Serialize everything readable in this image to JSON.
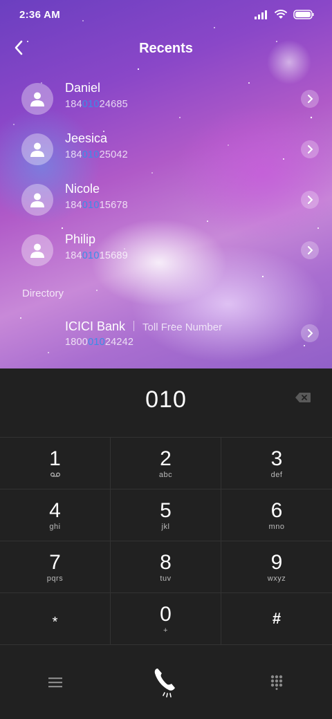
{
  "status": {
    "time": "2:36 AM"
  },
  "header": {
    "title": "Recents"
  },
  "contacts": [
    {
      "name": "Daniel",
      "num_pre": "184",
      "num_hl": "010",
      "num_post": "24685"
    },
    {
      "name": "Jeesica",
      "num_pre": "184",
      "num_hl": "010",
      "num_post": "25042"
    },
    {
      "name": "Nicole",
      "num_pre": "184",
      "num_hl": "010",
      "num_post": "15678"
    },
    {
      "name": "Philip",
      "num_pre": "184",
      "num_hl": "010",
      "num_post": "15689"
    }
  ],
  "directory": {
    "label": "Directory",
    "entry": {
      "name": "ICICI Bank",
      "subtitle": "Toll Free Number",
      "num_pre": "1800",
      "num_hl": "010",
      "num_post": "24242"
    }
  },
  "dialer": {
    "input": "010",
    "keys": [
      {
        "digit": "1",
        "letters": ""
      },
      {
        "digit": "2",
        "letters": "abc"
      },
      {
        "digit": "3",
        "letters": "def"
      },
      {
        "digit": "4",
        "letters": "ghi"
      },
      {
        "digit": "5",
        "letters": "jkl"
      },
      {
        "digit": "6",
        "letters": "mno"
      },
      {
        "digit": "7",
        "letters": "pqrs"
      },
      {
        "digit": "8",
        "letters": "tuv"
      },
      {
        "digit": "9",
        "letters": "wxyz"
      },
      {
        "digit": "*",
        "letters": ""
      },
      {
        "digit": "0",
        "letters": "+"
      },
      {
        "digit": "#",
        "letters": ""
      }
    ]
  },
  "icons": {
    "back": "chevron-left-icon",
    "avatar": "person-icon",
    "row_action": "chevron-right-icon",
    "backspace": "backspace-icon",
    "voicemail": "voicemail-icon",
    "menu": "menu-icon",
    "call": "phone-icon",
    "keypad_toggle": "dialpad-icon"
  },
  "colors": {
    "highlight": "#3a8de8",
    "dialer_bg": "#212121",
    "text": "#ffffff"
  }
}
